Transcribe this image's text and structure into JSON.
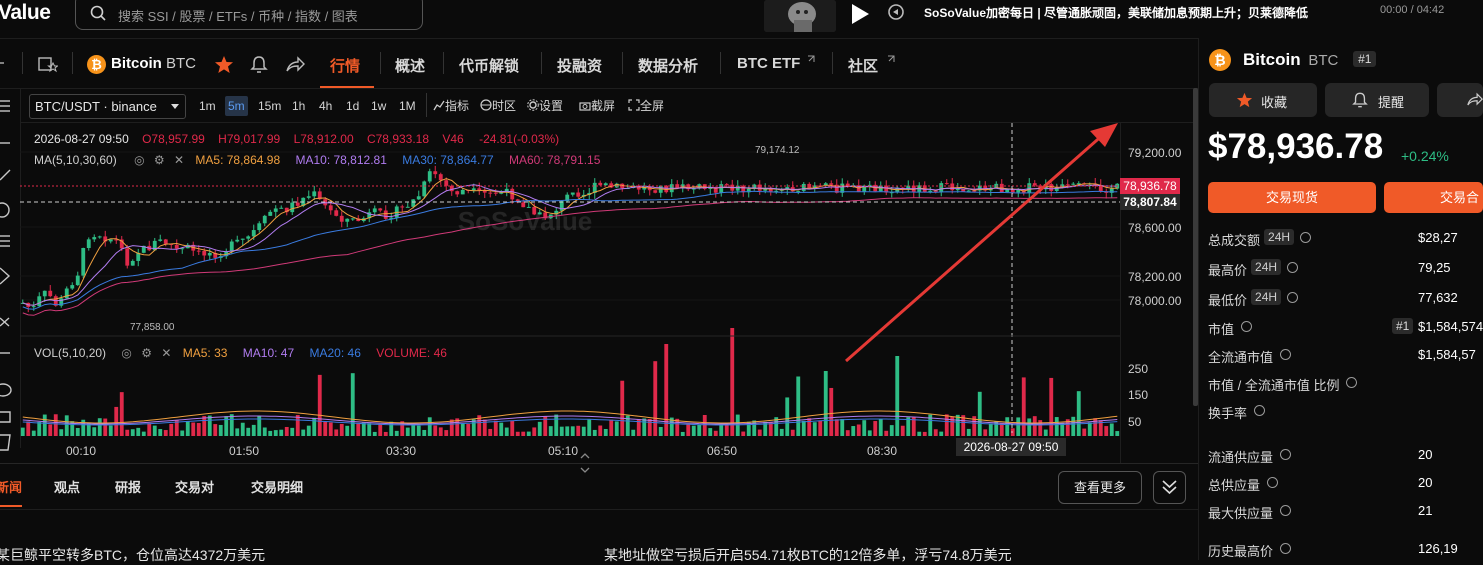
{
  "header": {
    "logo_text": "Value",
    "search_placeholder": "搜索 SSI / 股票 / ETFs / 币种 / 指数 / 图表",
    "ticker_text": "SoSoValue加密每日 | 尽管通胀顽固，美联储加息预期上升；贝莱德降低",
    "timer": "00:00 / 04:42"
  },
  "coin_tabs": {
    "coin_name": "Bitcoin",
    "coin_symbol": "BTC",
    "tabs": [
      "行情",
      "概述",
      "代币解锁",
      "投融资",
      "数据分析",
      "BTC ETF",
      "社区"
    ]
  },
  "chart_toolbar": {
    "pair": "BTC/USDT · binance",
    "intervals": [
      "1m",
      "5m",
      "15m",
      "1h",
      "4h",
      "1d",
      "1w",
      "1M"
    ],
    "active_interval": "5m",
    "tools": [
      "指标",
      "时区",
      "设置",
      "截屏",
      "全屏"
    ]
  },
  "chart_info": {
    "datetime": "2026-08-27 09:50",
    "open": "O78,957.99",
    "high": "H79,017.99",
    "low": "L78,912.00",
    "close": "C78,933.18",
    "volume": "V46",
    "change": "-24.81(-0.03%)",
    "ma_label": "MA(5,10,30,60)",
    "ma5": "MA5: 78,864.98",
    "ma10": "MA10: 78,812.81",
    "ma30": "MA30: 78,864.77",
    "ma60": "MA60: 78,791.15",
    "vol_label": "VOL(5,10,20)",
    "vol_ma5": "MA5: 33",
    "vol_ma10": "MA10: 47",
    "vol_ma20": "MA20: 46",
    "vol_volume": "VOLUME: 46",
    "high_marker": "79,174.12",
    "low_marker": "77,858.00",
    "price_tag": "78,936.78",
    "cross_tag": "78,807.84",
    "cross_time": "2026-08-27 09:50",
    "watermark": "SoSoValue"
  },
  "chart_data": {
    "type": "candlestick",
    "y_ticks": [
      "79,200.00",
      "78,600.00",
      "78,200.00",
      "78,000.00"
    ],
    "vol_ticks": [
      "250",
      "150",
      "50"
    ],
    "x_ticks": [
      "00:10",
      "01:50",
      "03:30",
      "05:10",
      "06:50",
      "08:30"
    ],
    "colors": {
      "up": "#2ebd85",
      "down": "#e0294a",
      "ma5": "#f0a040",
      "ma10": "#b07cf0",
      "ma30": "#3a7be0",
      "ma60": "#d03a78"
    }
  },
  "bottom": {
    "tabs": [
      "新闻",
      "观点",
      "研报",
      "交易对",
      "交易明细"
    ],
    "more_button": "查看更多",
    "news": [
      "某巨鲸平空转多BTC，仓位高达4372万美元",
      "某地址做空亏损后开启554.71枚BTC的12倍多单，浮亏74.8万美元"
    ]
  },
  "right_panel": {
    "coin_name": "Bitcoin",
    "coin_symbol": "BTC",
    "rank": "#1",
    "favorite_label": "收藏",
    "alert_label": "提醒",
    "price": "$78,936.78",
    "change": "+0.24%",
    "spot_button": "交易现货",
    "contract_button": "交易合",
    "stats": [
      {
        "label": "总成交额",
        "pill": "24H",
        "value": "$28,27"
      },
      {
        "label": "最高价",
        "pill": "24H",
        "value": "79,25"
      },
      {
        "label": "最低价",
        "pill": "24H",
        "value": "77,632"
      },
      {
        "label": "市值",
        "pill": "",
        "value": "$1,584,574",
        "rank": "#1"
      },
      {
        "label": "全流通市值",
        "pill": "",
        "value": "$1,584,57"
      },
      {
        "label": "市值 / 全流通市值 比例",
        "pill": "",
        "value": ""
      },
      {
        "label": "换手率",
        "pill": "",
        "value": ""
      },
      {
        "label": "流通供应量",
        "pill": "",
        "value": "20"
      },
      {
        "label": "总供应量",
        "pill": "",
        "value": "20"
      },
      {
        "label": "最大供应量",
        "pill": "",
        "value": "21"
      },
      {
        "label": "历史最高价",
        "pill": "",
        "value": "126,19"
      }
    ]
  }
}
